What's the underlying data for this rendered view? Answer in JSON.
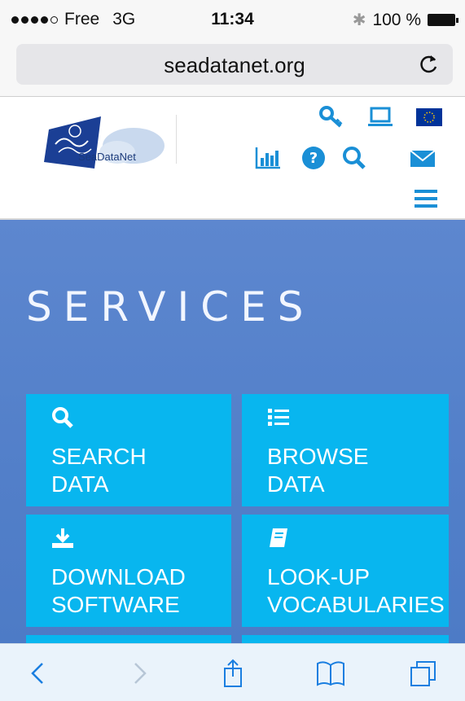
{
  "status_bar": {
    "carrier": "Free",
    "network": "3G",
    "time": "11:34",
    "battery": "100 %"
  },
  "browser": {
    "url": "seadatanet.org"
  },
  "site": {
    "logo_text": "SeaDataNet",
    "accent_color": "#1a8fd6"
  },
  "hero": {
    "title": "SERVICES",
    "tiles": [
      {
        "label": "SEARCH\nDATA",
        "icon": "search-icon"
      },
      {
        "label": "BROWSE\nDATA",
        "icon": "list-icon"
      },
      {
        "label": "DOWNLOAD\nSOFTWARE",
        "icon": "download-icon"
      },
      {
        "label": "LOOK-UP\nVOCABULARIES",
        "icon": "book-icon"
      }
    ]
  },
  "colors": {
    "tile": "#08b6ef",
    "hero": "#5a85cc"
  }
}
